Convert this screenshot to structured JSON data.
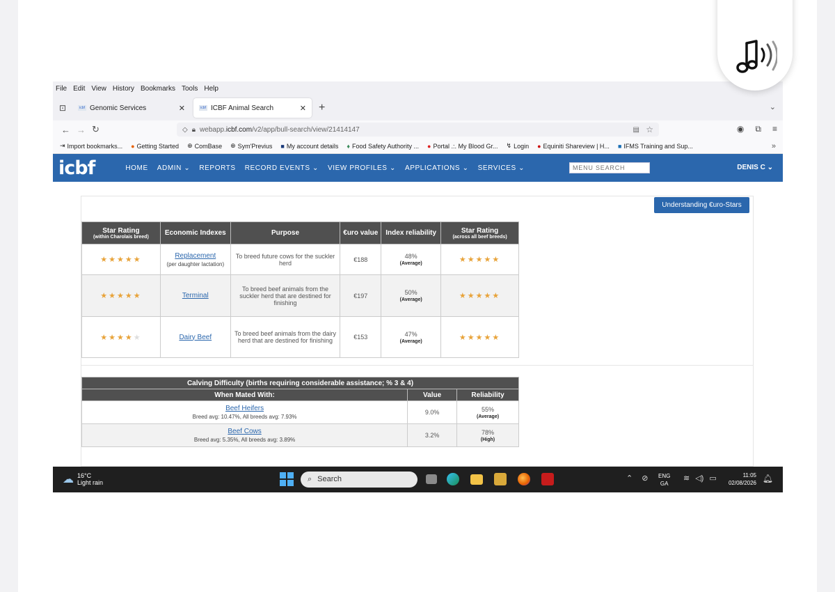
{
  "browser": {
    "menu": [
      "File",
      "Edit",
      "View",
      "History",
      "Bookmarks",
      "Tools",
      "Help"
    ],
    "tabs": [
      {
        "label": "Genomic Services",
        "active": false
      },
      {
        "label": "ICBF Animal Search",
        "active": true
      }
    ],
    "url_prefix": "webapp.",
    "url_host": "icbf.com",
    "url_path": "/v2/app/bull-search/view/21414147",
    "bookmarks": [
      "Import bookmarks...",
      "Getting Started",
      "ComBase",
      "Sym'Previus",
      "My account details",
      "Food Safety Authority ...",
      "Portal .:. My Blood Gr...",
      "Login",
      "Equiniti Shareview | H...",
      "IFMS Training and Sup..."
    ]
  },
  "app": {
    "logo": "icbf",
    "nav": [
      "HOME",
      "ADMIN ⌄",
      "REPORTS",
      "RECORD EVENTS ⌄",
      "VIEW PROFILES ⌄",
      "APPLICATIONS ⌄",
      "SERVICES ⌄"
    ],
    "menu_search_placeholder": "MENU SEARCH",
    "user": "DENIS C ⌄",
    "accent_color": "#2b67ad"
  },
  "eurostars_button": "Understanding €uro-Stars",
  "index_table": {
    "headers": {
      "star_rating_breed": "Star Rating",
      "star_rating_breed_sub": "(within Charolais breed)",
      "economic_indexes": "Economic Indexes",
      "purpose": "Purpose",
      "euro_value": "€uro value",
      "index_reliability": "Index reliability",
      "star_rating_all": "Star Rating",
      "star_rating_all_sub": "(across all beef breeds)"
    },
    "rows": [
      {
        "breed_stars": 5,
        "index": "Replacement",
        "index_note": "(per daughter lactation)",
        "purpose": "To breed future cows for the suckler herd",
        "euro": "€188",
        "reliability": "48%",
        "reliability_label": "(Average)",
        "all_stars": 5
      },
      {
        "breed_stars": 5,
        "index": "Terminal",
        "index_note": "",
        "purpose": "To breed beef animals from the suckler herd that are destined for finishing",
        "euro": "€197",
        "reliability": "50%",
        "reliability_label": "(Average)",
        "all_stars": 5
      },
      {
        "breed_stars": 4,
        "index": "Dairy Beef",
        "index_note": "",
        "purpose": "To breed beef animals from the dairy herd that are destined for finishing",
        "euro": "€153",
        "reliability": "47%",
        "reliability_label": "(Average)",
        "all_stars": 5
      }
    ]
  },
  "calving_table": {
    "title": "Calving Difficulty (births requiring considerable assistance; % 3 & 4)",
    "headers": {
      "mated_with": "When Mated With:",
      "value": "Value",
      "reliability": "Reliability"
    },
    "rows": [
      {
        "label": "Beef Heifers",
        "note": "Breed avg: 10.47%, All breeds avg: 7.93%",
        "value": "9.0%",
        "reliability": "55%",
        "reliability_label": "(Average)"
      },
      {
        "label": "Beef Cows",
        "note": "Breed avg: 5.35%, All breeds avg: 3.89%",
        "value": "3.2%",
        "reliability": "78%",
        "reliability_label": "(High)"
      }
    ]
  },
  "taskbar": {
    "temp": "16°C",
    "weather": "Light rain",
    "search_placeholder": "Search",
    "lang": "ENG",
    "lang_sub": "GA",
    "time": "11:05",
    "date": "02/08/2026"
  }
}
